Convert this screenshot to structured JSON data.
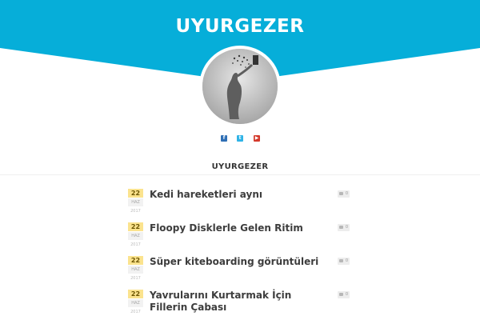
{
  "header": {
    "title": "UYURGEZER",
    "accent_color": "#06aed9"
  },
  "profile": {
    "avatar_alt": "avatar"
  },
  "socials": [
    {
      "icon": "facebook-icon",
      "glyph": "f",
      "color": "#2f6fb5"
    },
    {
      "icon": "twitter-icon",
      "glyph": "t",
      "color": "#2fb3e6"
    },
    {
      "icon": "youtube-icon",
      "glyph": "▶",
      "color": "#d43a2c"
    }
  ],
  "blog": {
    "name": "UYURGEZER"
  },
  "posts": [
    {
      "day": "22",
      "month": "HAZ",
      "year": "2017",
      "title": "Kedi hareketleri aynı",
      "comments": "0"
    },
    {
      "day": "22",
      "month": "HAZ",
      "year": "2017",
      "title": "Floopy Disklerle Gelen Ritim",
      "comments": "0"
    },
    {
      "day": "22",
      "month": "HAZ",
      "year": "2017",
      "title": "Süper kiteboarding görüntüleri",
      "comments": "0"
    },
    {
      "day": "22",
      "month": "HAZ",
      "year": "2017",
      "title": "Yavrularını Kurtarmak İçin Fillerin Çabası",
      "comments": "0"
    }
  ]
}
